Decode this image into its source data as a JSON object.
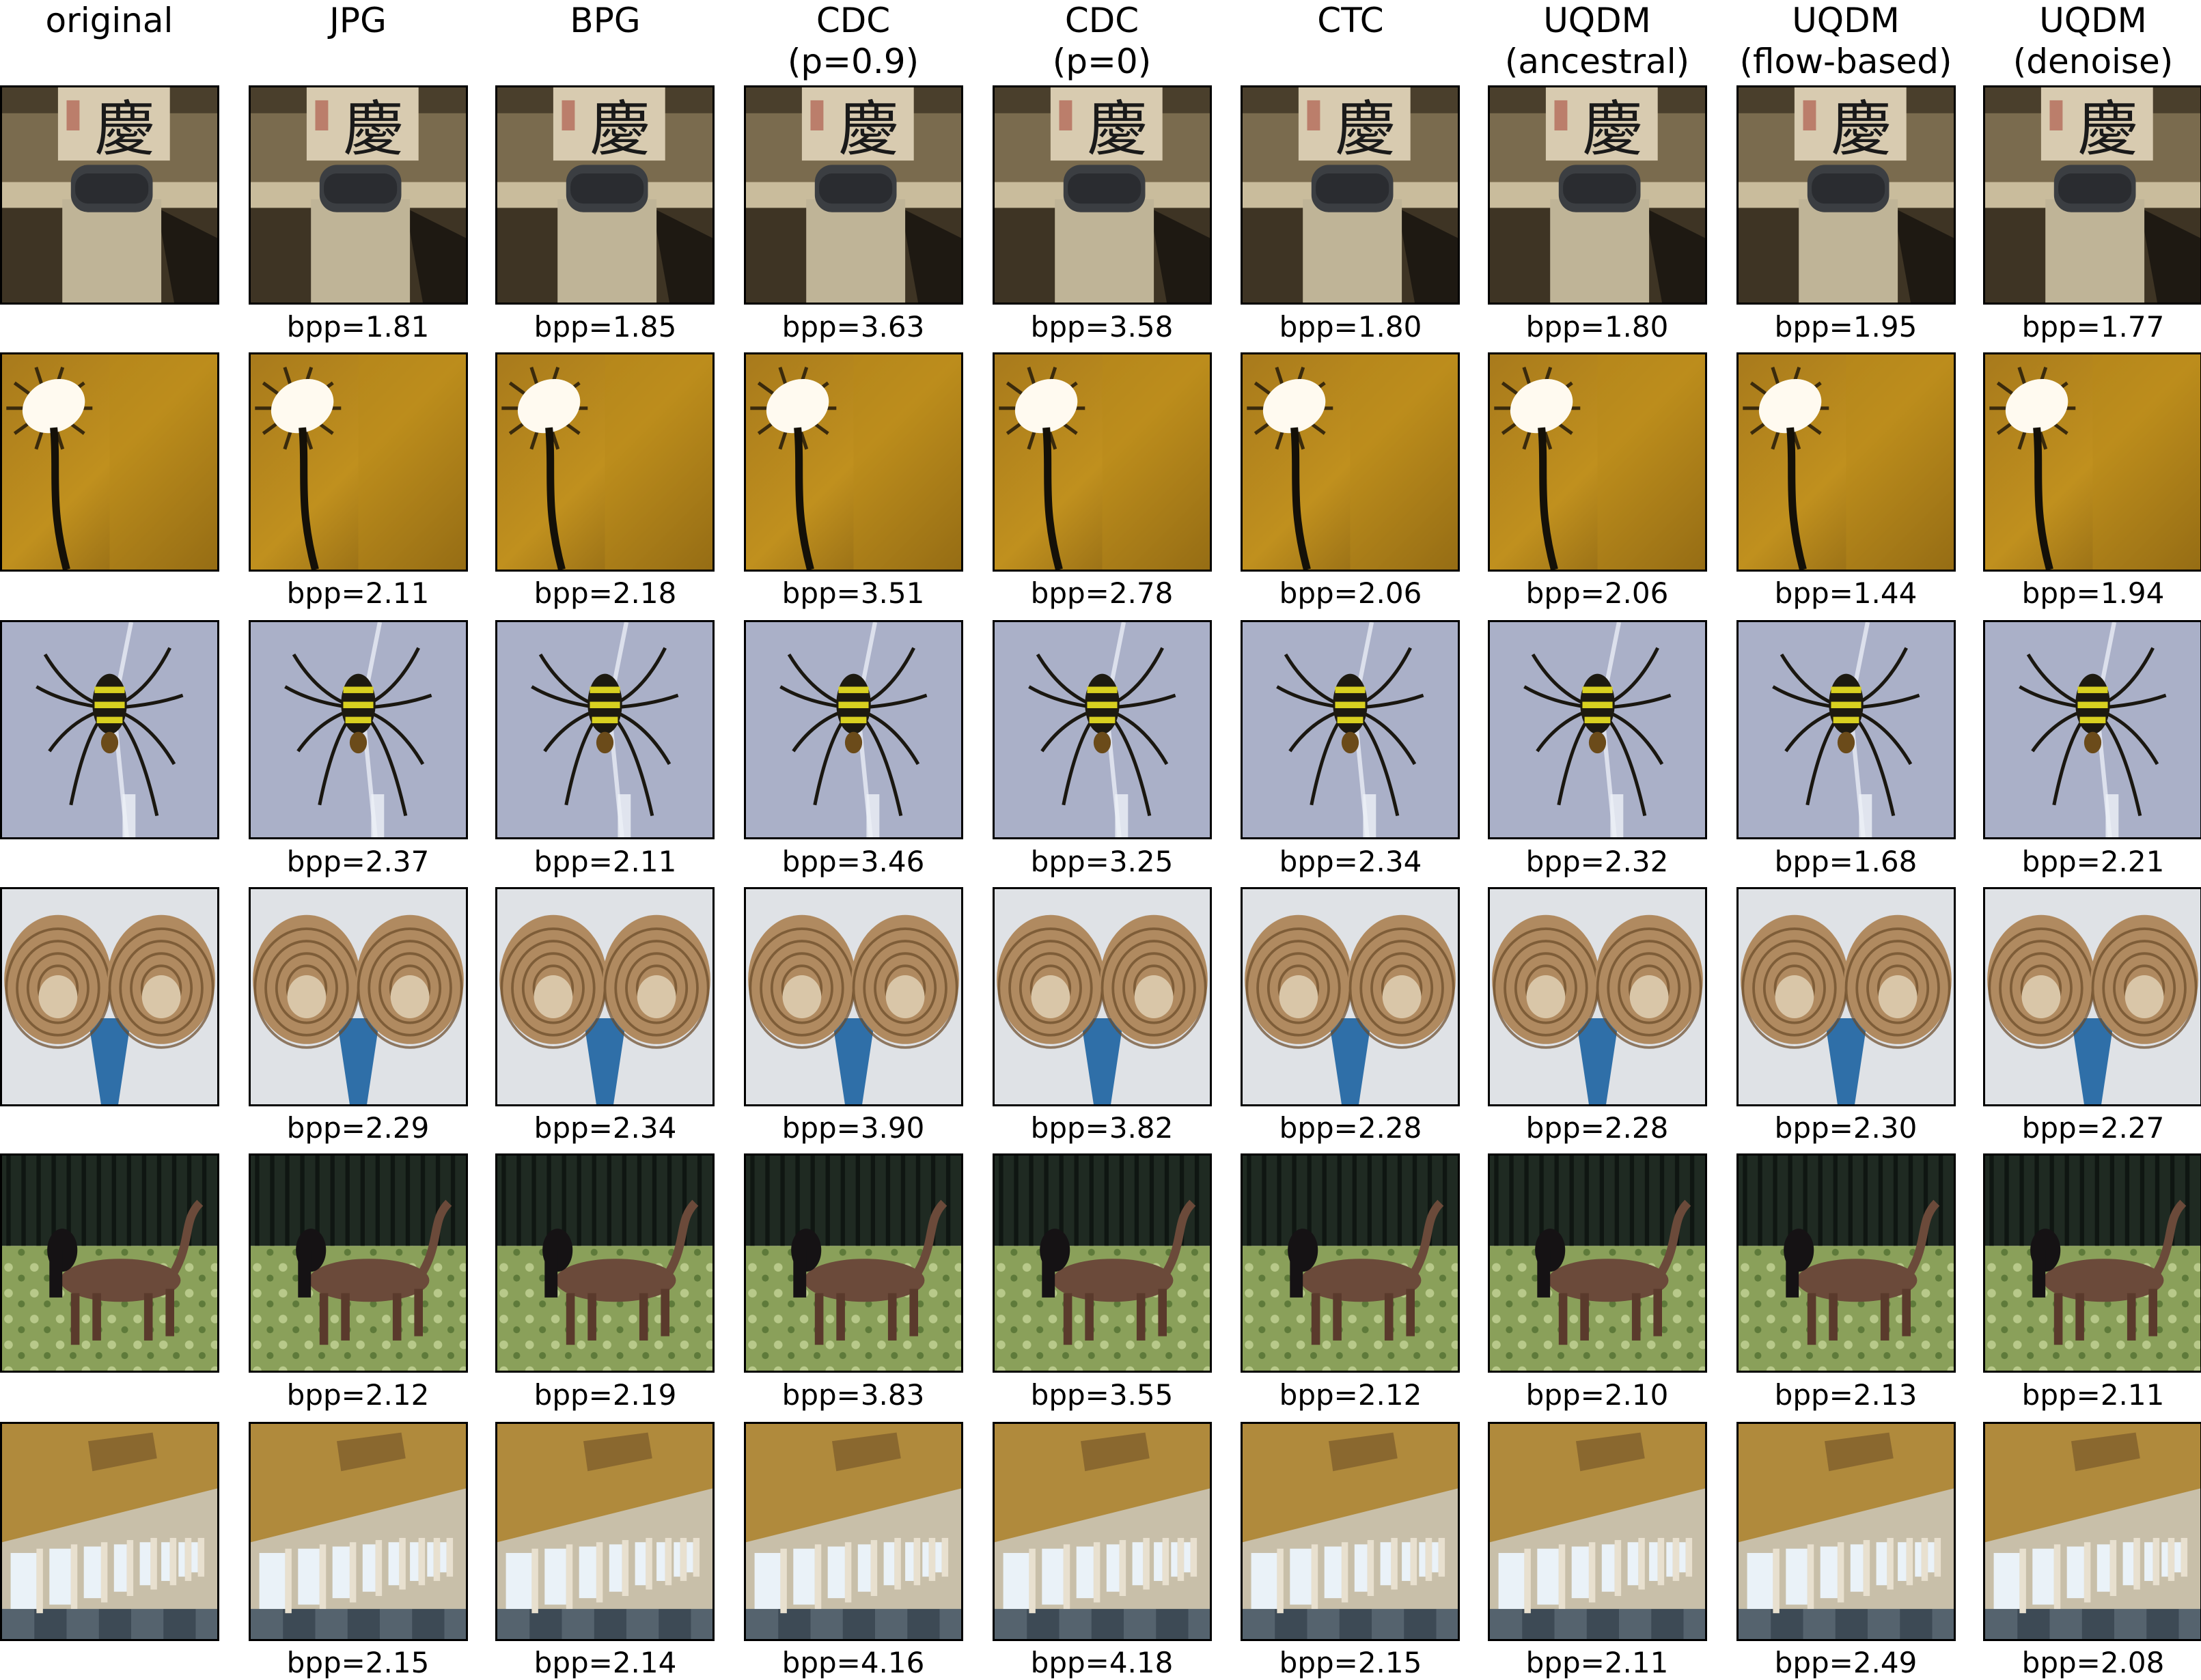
{
  "columns": [
    {
      "id": "original",
      "label": "original"
    },
    {
      "id": "jpg",
      "label": "JPG"
    },
    {
      "id": "bpg",
      "label": "BPG"
    },
    {
      "id": "cdc-09",
      "label": "CDC\n(p=0.9)"
    },
    {
      "id": "cdc-0",
      "label": "CDC\n(p=0)"
    },
    {
      "id": "ctc",
      "label": "CTC"
    },
    {
      "id": "uqdm-ancestral",
      "label": "UQDM\n(ancestral)"
    },
    {
      "id": "uqdm-flow",
      "label": "UQDM\n(flow-based)"
    },
    {
      "id": "uqdm-denoise",
      "label": "UQDM\n(denoise)"
    }
  ],
  "rows": [
    {
      "subject": "calligraphy-scene",
      "bpp": [
        "bpp=1.81",
        "bpp=1.85",
        "bpp=3.63",
        "bpp=3.58",
        "bpp=1.80",
        "bpp=1.80",
        "bpp=1.95",
        "bpp=1.77"
      ]
    },
    {
      "subject": "lamp-scene",
      "bpp": [
        "bpp=2.11",
        "bpp=2.18",
        "bpp=3.51",
        "bpp=2.78",
        "bpp=2.06",
        "bpp=2.06",
        "bpp=1.44",
        "bpp=1.94"
      ]
    },
    {
      "subject": "spider-scene",
      "bpp": [
        "bpp=2.37",
        "bpp=2.11",
        "bpp=3.46",
        "bpp=3.25",
        "bpp=2.34",
        "bpp=2.32",
        "bpp=1.68",
        "bpp=2.21"
      ]
    },
    {
      "subject": "shells-scene",
      "bpp": [
        "bpp=2.29",
        "bpp=2.34",
        "bpp=3.90",
        "bpp=3.82",
        "bpp=2.28",
        "bpp=2.28",
        "bpp=2.30",
        "bpp=2.27"
      ]
    },
    {
      "subject": "dog-scene",
      "bpp": [
        "bpp=2.12",
        "bpp=2.19",
        "bpp=3.83",
        "bpp=3.55",
        "bpp=2.12",
        "bpp=2.10",
        "bpp=2.13",
        "bpp=2.11"
      ]
    },
    {
      "subject": "hall-scene",
      "bpp": [
        "bpp=2.15",
        "bpp=2.14",
        "bpp=4.16",
        "bpp=4.18",
        "bpp=2.15",
        "bpp=2.11",
        "bpp=2.49",
        "bpp=2.08"
      ]
    }
  ],
  "calligraphy_glyph": "慶"
}
